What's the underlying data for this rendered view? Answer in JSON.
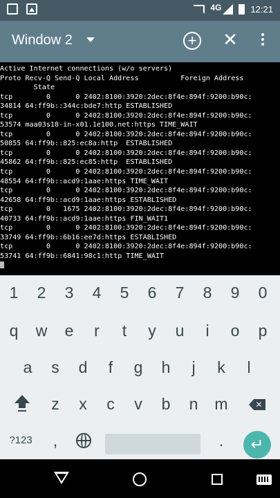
{
  "status_bar": {
    "network": "4G",
    "time": "12:21"
  },
  "app_bar": {
    "title": "Window 2"
  },
  "terminal": {
    "lines": [
      "Active Internet connections (w/o servers)",
      "Proto Recv-Q Send-Q Local Address          Foreign Address",
      "        State",
      "tcp        0      0 2402:8100:3920:2dec:8f4e:894f:9200:b90c:",
      "34814 64:ff9b::344c:bde7:http ESTABLISHED",
      "tcp        0      0 2402:8100:3920:2dec:8f4e:894f:9200:b90c:",
      "53574 maa03s18-in-x01.1e100.net:https TIME_WAIT",
      "tcp        0      0 2402:8100:3920:2dec:8f4e:894f:9200:b90c:",
      "50855 64:ff9b::825:ec8a:http  ESTABLISHED",
      "tcp        0      0 2402:8100:3920:2dec:8f4e:894f:9200:b90c:",
      "45862 64:ff9b::825:ec85:http  ESTABLISHED",
      "tcp        0      0 2402:8100:3920:2dec:8f4e:894f:9200:b90c:",
      "48554 64:ff9b::acd9:1aae:https TIME_WAIT",
      "tcp        0      0 2402:8100:3920:2dec:8f4e:894f:9200:b90c:",
      "42658 64:ff9b::acd9:1aae:https ESTABLISHED",
      "tcp        0   1675 2402:8100:3920:2dec:8f4e:894f:9200:b90c:",
      "40733 64:ff9b::acd9:1aae:https FIN_WAIT1",
      "tcp        0      0 2402:8100:3920:2dec:8f4e:894f:9200:b90c:",
      "33749 64:ff9b::6b16:ee7d:https ESTABLISHED",
      "tcp        0      0 2402:8100:3920:2dec:8f4e:894f:9200:b90c:",
      "53741 64:ff9b::6841:98c1:http TIME_WAIT"
    ]
  },
  "keyboard": {
    "numbers": [
      "1",
      "2",
      "3",
      "4",
      "5",
      "6",
      "7",
      "8",
      "9",
      "0"
    ],
    "row1": [
      "q",
      "w",
      "e",
      "r",
      "t",
      "y",
      "u",
      "i",
      "o",
      "p"
    ],
    "row2": [
      "a",
      "s",
      "d",
      "f",
      "g",
      "h",
      "j",
      "k",
      "l"
    ],
    "row3": [
      "z",
      "x",
      "c",
      "v",
      "b",
      "n",
      "m"
    ],
    "symbols_label": "?123",
    "comma": ",",
    "period": ".",
    "accent_color": "#4db6ac"
  },
  "icons": {
    "status": [
      "notification-icon",
      "gallery-icon",
      "cast-icon",
      "signal-icon",
      "battery-icon"
    ],
    "app_bar": [
      "dropdown-icon",
      "add-icon",
      "close-icon",
      "more-icon"
    ],
    "keyboard": [
      "shift-icon",
      "backspace-icon",
      "globe-icon",
      "enter-icon"
    ],
    "nav": [
      "back-icon",
      "home-icon",
      "recents-icon",
      "keyboard-switch-icon"
    ]
  }
}
